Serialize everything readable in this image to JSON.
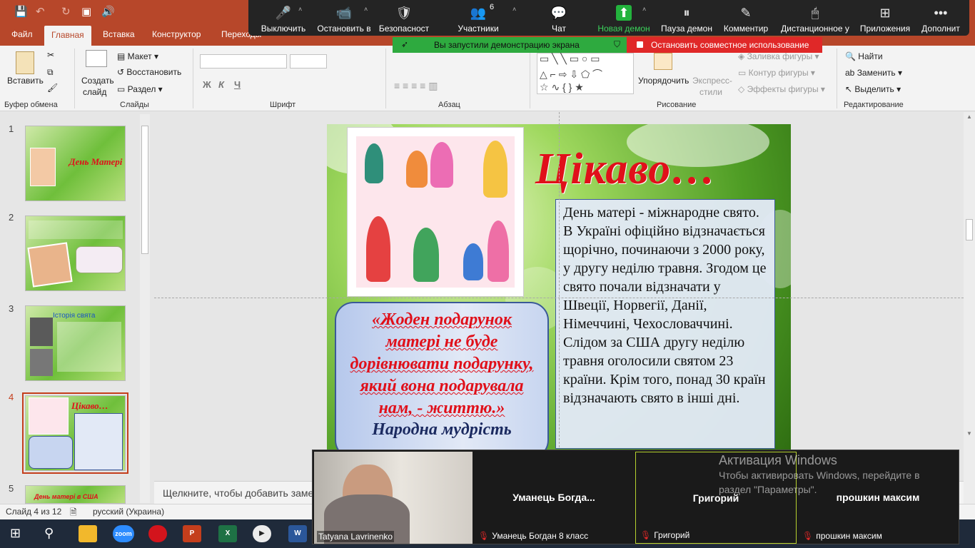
{
  "quick_access": {
    "save": "💾",
    "undo": "↶",
    "redo": "↻",
    "present": "▣",
    "sound": "🔊"
  },
  "ribbon_tabs": [
    {
      "label": "Файл"
    },
    {
      "label": "Главная"
    },
    {
      "label": "Вставка"
    },
    {
      "label": "Конструктор"
    },
    {
      "label": "Переходы"
    }
  ],
  "ribbon": {
    "clipboard": {
      "paste": "Вставить",
      "group": "Буфер обмена"
    },
    "slides": {
      "new_slide_line1": "Создать",
      "new_slide_line2": "слайд",
      "layout": "Макет",
      "reset": "Восстановить",
      "section": "Раздел",
      "group": "Слайды"
    },
    "font": {
      "bold": "Ж",
      "italic": "К",
      "underline": "Ч",
      "group": "Шрифт"
    },
    "paragraph": {
      "group": "Абзац"
    },
    "drawing": {
      "arrange": "Упорядочить",
      "styles_line1": "Экспресс-",
      "styles_line2": "стили",
      "fill": "Заливка фигуры",
      "outline": "Контур фигуры",
      "effects": "Эффекты фигуры",
      "group": "Рисование"
    },
    "editing": {
      "find": "Найти",
      "replace": "Заменить",
      "select": "Выделить",
      "group": "Редактирование"
    }
  },
  "zoom_toolbar": {
    "items": [
      {
        "label": "Выключить",
        "icon": "🎤"
      },
      {
        "label": "Остановить в",
        "icon": "📹"
      },
      {
        "label": "Безопасност",
        "icon": "🛡"
      },
      {
        "label": "Участники",
        "icon": "👥",
        "count": "6"
      },
      {
        "label": "Чат",
        "icon": "💬"
      },
      {
        "label": "Новая демон",
        "icon": "⬆"
      },
      {
        "label": "Пауза демон",
        "icon": "⏸"
      },
      {
        "label": "Комментир",
        "icon": "✎"
      },
      {
        "label": "Дистанционное у",
        "icon": "🖱"
      },
      {
        "label": "Приложения",
        "icon": "⊞"
      },
      {
        "label": "Дополнит",
        "icon": "•••"
      }
    ],
    "demo_banner": "Вы запустили демонстрацию экрана",
    "stop_banner": "Остановить совместное использование"
  },
  "slides_panel": {
    "numbers": [
      "1",
      "2",
      "3",
      "4",
      "5"
    ],
    "t1_title": "День Матері",
    "t3_title": "Історія свята",
    "t4_title": "Цікаво…",
    "t5_title": "День матері в США"
  },
  "slide": {
    "title": "Цікаво…",
    "body": "День матері - міжнародне свято. В Україні офіційно відзначається щорічно, починаючи з 2000 року, у другу неділю травня. Згодом це свято почали відзначати у Швеції, Норвегії, Данії, Німеччині, Чехословаччині. Слідом за США другу неділю травня оголосили святом 23 країни. Крім того, понад 30 країн відзначають свято в інші дні.",
    "quote": "«Жоден подарунок матері не буде дорівнювати подарунку, який вона подарувала нам, - життю.»",
    "quote_author": "Народна мудрість"
  },
  "notes_placeholder": "Щелкните, чтобы добавить заметки",
  "status": {
    "slide_info": "Слайд 4 из 12",
    "language": "русский (Украина)"
  },
  "taskbar": {
    "zoom": "zoom",
    "powerpoint": "P",
    "excel": "X",
    "word": "W"
  },
  "video": {
    "tiles": [
      {
        "name": "Tatyana Lavrinenko"
      },
      {
        "name": "Уманець  Богда...",
        "footer": "Уманець Богдан 8 класс"
      },
      {
        "name": "Григорий",
        "footer": "Григорий"
      },
      {
        "name": "прошкин максим",
        "footer": "прошкин максим"
      }
    ]
  },
  "activation": {
    "title": "Активация Windows",
    "text": "Чтобы активировать Windows, перейдите в раздел \"Параметры\"."
  }
}
